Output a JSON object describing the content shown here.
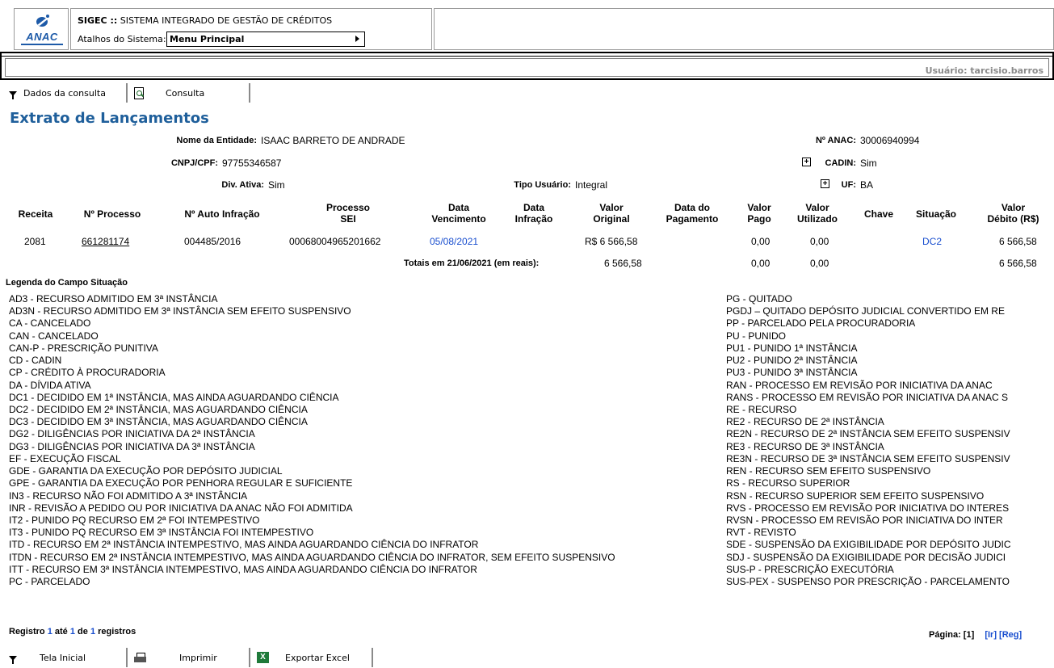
{
  "header": {
    "logo_text": "ANAC",
    "sys_name": "SIGEC ::",
    "sys_desc": "SISTEMA INTEGRADO DE GESTÃO DE CRÉDITOS",
    "shortcuts_label": "Atalhos do Sistema:",
    "shortcuts_value": "Menu Principal"
  },
  "user_bar": {
    "user": "Usuário: tarcisio.barros"
  },
  "toolbar": {
    "dados_label": "Dados da consulta",
    "consulta_label": "Consulta"
  },
  "page_title": "Extrato de Lançamentos",
  "info": {
    "entidade_label": "Nome da Entidade:",
    "entidade_value": "ISAAC BARRETO DE ANDRADE",
    "anac_label": "Nº ANAC:",
    "anac_value": "30006940994",
    "cnpj_label": "CNPJ/CPF:",
    "cnpj_value": "97755346587",
    "cadin_label": "CADIN:",
    "cadin_value": "Sim",
    "divativa_label": "Div. Ativa:",
    "divativa_value": "Sim",
    "tipo_label": "Tipo Usuário:",
    "tipo_value": "Integral",
    "uf_label": "UF:",
    "uf_value": "BA",
    "plus": "+"
  },
  "table": {
    "headers": {
      "receita": "Receita",
      "processo": "Nº Processo",
      "auto": "Nº Auto Infração",
      "sei_1": "Processo",
      "sei_2": "SEI",
      "venc_1": "Data",
      "venc_2": "Vencimento",
      "infr_1": "Data",
      "infr_2": "Infração",
      "vorig_1": "Valor",
      "vorig_2": "Original",
      "dpag_1": "Data do",
      "dpag_2": "Pagamento",
      "vpago_1": "Valor",
      "vpago_2": "Pago",
      "vutil_1": "Valor",
      "vutil_2": "Utilizado",
      "chave": "Chave",
      "situacao": "Situação",
      "vdeb_1": "Valor",
      "vdeb_2": "Débito (R$)"
    },
    "row": {
      "receita": "2081",
      "processo": "661281174",
      "auto": "004485/2016",
      "sei": "00068004965201662",
      "vencimento": "05/08/2021",
      "infracao": "",
      "valor_original": "R$ 6 566,58",
      "data_pagamento": "",
      "valor_pago": "0,00",
      "valor_utilizado": "0,00",
      "chave": "",
      "situacao": "DC2",
      "valor_debito": "6 566,58"
    },
    "totals": {
      "label": "Totais em 21/06/2021 (em reais):",
      "original": "6 566,58",
      "pago": "0,00",
      "utilizado": "0,00",
      "debito": "6 566,58"
    }
  },
  "legend": {
    "title": "Legenda do Campo Situação",
    "left": [
      "AD3 - RECURSO ADMITIDO EM 3ª INSTÂNCIA",
      "AD3N - RECURSO ADMITIDO EM 3ª INSTÂNCIA SEM EFEITO SUSPENSIVO",
      "CA - CANCELADO",
      "CAN - CANCELADO",
      "CAN-P - PRESCRIÇÃO PUNITIVA",
      "CD - CADIN",
      "CP - CRÉDITO À PROCURADORIA",
      "DA - DÍVIDA ATIVA",
      "DC1 - DECIDIDO EM 1ª INSTÂNCIA, MAS AINDA AGUARDANDO CIÊNCIA",
      "DC2 - DECIDIDO EM 2ª INSTÂNCIA, MAS AGUARDANDO CIÊNCIA",
      "DC3 - DECIDIDO EM 3ª INSTÂNCIA, MAS AGUARDANDO CIÊNCIA",
      "DG2 - DILIGÊNCIAS POR INICIATIVA DA 2ª INSTÂNCIA",
      "DG3 - DILIGÊNCIAS POR INICIATIVA DA 3ª INSTÂNCIA",
      "EF - EXECUÇÃO FISCAL",
      "GDE - GARANTIA DA EXECUÇÃO POR DEPÓSITO JUDICIAL",
      "GPE - GARANTIA DA EXECUÇÃO POR PENHORA REGULAR E SUFICIENTE",
      "IN3 - RECURSO NÃO FOI ADMITIDO A 3ª INSTÂNCIA",
      "INR - REVISÃO A PEDIDO OU POR INICIATIVA DA ANAC NÃO FOI ADMITIDA",
      "IT2 - PUNIDO PQ RECURSO EM 2ª FOI INTEMPESTIVO",
      "IT3 - PUNIDO PQ RECURSO EM 3ª INSTÂNCIA FOI INTEMPESTIVO",
      "ITD - RECURSO EM 2ª INSTÂNCIA INTEMPESTIVO, MAS AINDA AGUARDANDO CIÊNCIA DO INFRATOR",
      "ITDN - RECURSO EM 2ª INSTÂNCIA INTEMPESTIVO, MAS AINDA AGUARDANDO CIÊNCIA DO INFRATOR, SEM EFEITO SUSPENSIVO",
      "ITT - RECURSO EM 3ª INSTÂNCIA INTEMPESTIVO, MAS AINDA AGUARDANDO CIÊNCIA DO INFRATOR",
      "PC - PARCELADO"
    ],
    "right": [
      "PG - QUITADO",
      "PGDJ – QUITADO DEPÓSITO JUDICIAL CONVERTIDO EM RE",
      "PP - PARCELADO PELA PROCURADORIA",
      "PU - PUNIDO",
      "PU1 - PUNIDO 1ª INSTÂNCIA",
      "PU2 - PUNIDO 2ª INSTÂNCIA",
      "PU3 - PUNIDO 3ª INSTÂNCIA",
      "RAN - PROCESSO EM REVISÃO POR INICIATIVA DA ANAC",
      "RANS - PROCESSO EM REVISÃO POR INICIATIVA DA ANAC S",
      "RE - RECURSO",
      "RE2 - RECURSO DE 2ª INSTÂNCIA",
      "RE2N - RECURSO DE 2ª INSTÂNCIA SEM EFEITO SUSPENSIV",
      "RE3 - RECURSO DE 3ª INSTÂNCIA",
      "RE3N - RECURSO DE 3ª INSTÂNCIA SEM EFEITO SUSPENSIV",
      "REN - RECURSO SEM EFEITO SUSPENSIVO",
      "RS - RECURSO SUPERIOR",
      "RSN - RECURSO SUPERIOR SEM EFEITO SUSPENSIVO",
      "RVS - PROCESSO EM REVISÃO POR INICIATIVA DO INTERES",
      "RVSN - PROCESSO EM REVISÃO POR INICIATIVA DO INTER",
      "RVT - REVISTO",
      "SDE - SUSPENSÃO DA EXIGIBILIDADE POR DEPÓSITO JUDIC",
      "SDJ - SUSPENSÃO DA EXIGIBILIDADE POR DECISÃO JUDICI",
      "SUS-P - PRESCRIÇÃO EXECUTÓRIA",
      "SUS-PEX - SUSPENSO POR PRESCRIÇÃO - PARCELAMENTO"
    ]
  },
  "footer": {
    "reg_prefix": "Registro",
    "reg_from": "1",
    "reg_ate": "até",
    "reg_to": "1",
    "reg_de": "de",
    "reg_total": "1",
    "reg_suffix": "registros",
    "page_label": "Página:",
    "page_current": "[1]",
    "page_ir": "[Ir]",
    "page_reg": "[Reg]",
    "tela_inicial": "Tela Inicial",
    "imprimir": "Imprimir",
    "exportar": "Exportar Excel",
    "xls_glyph": "X"
  },
  "colors": {
    "title_blue": "#1f5f9b",
    "link_blue": "#1a4fcf",
    "logo_blue": "#1d5aa8",
    "user_gray": "#8a8a8a"
  }
}
